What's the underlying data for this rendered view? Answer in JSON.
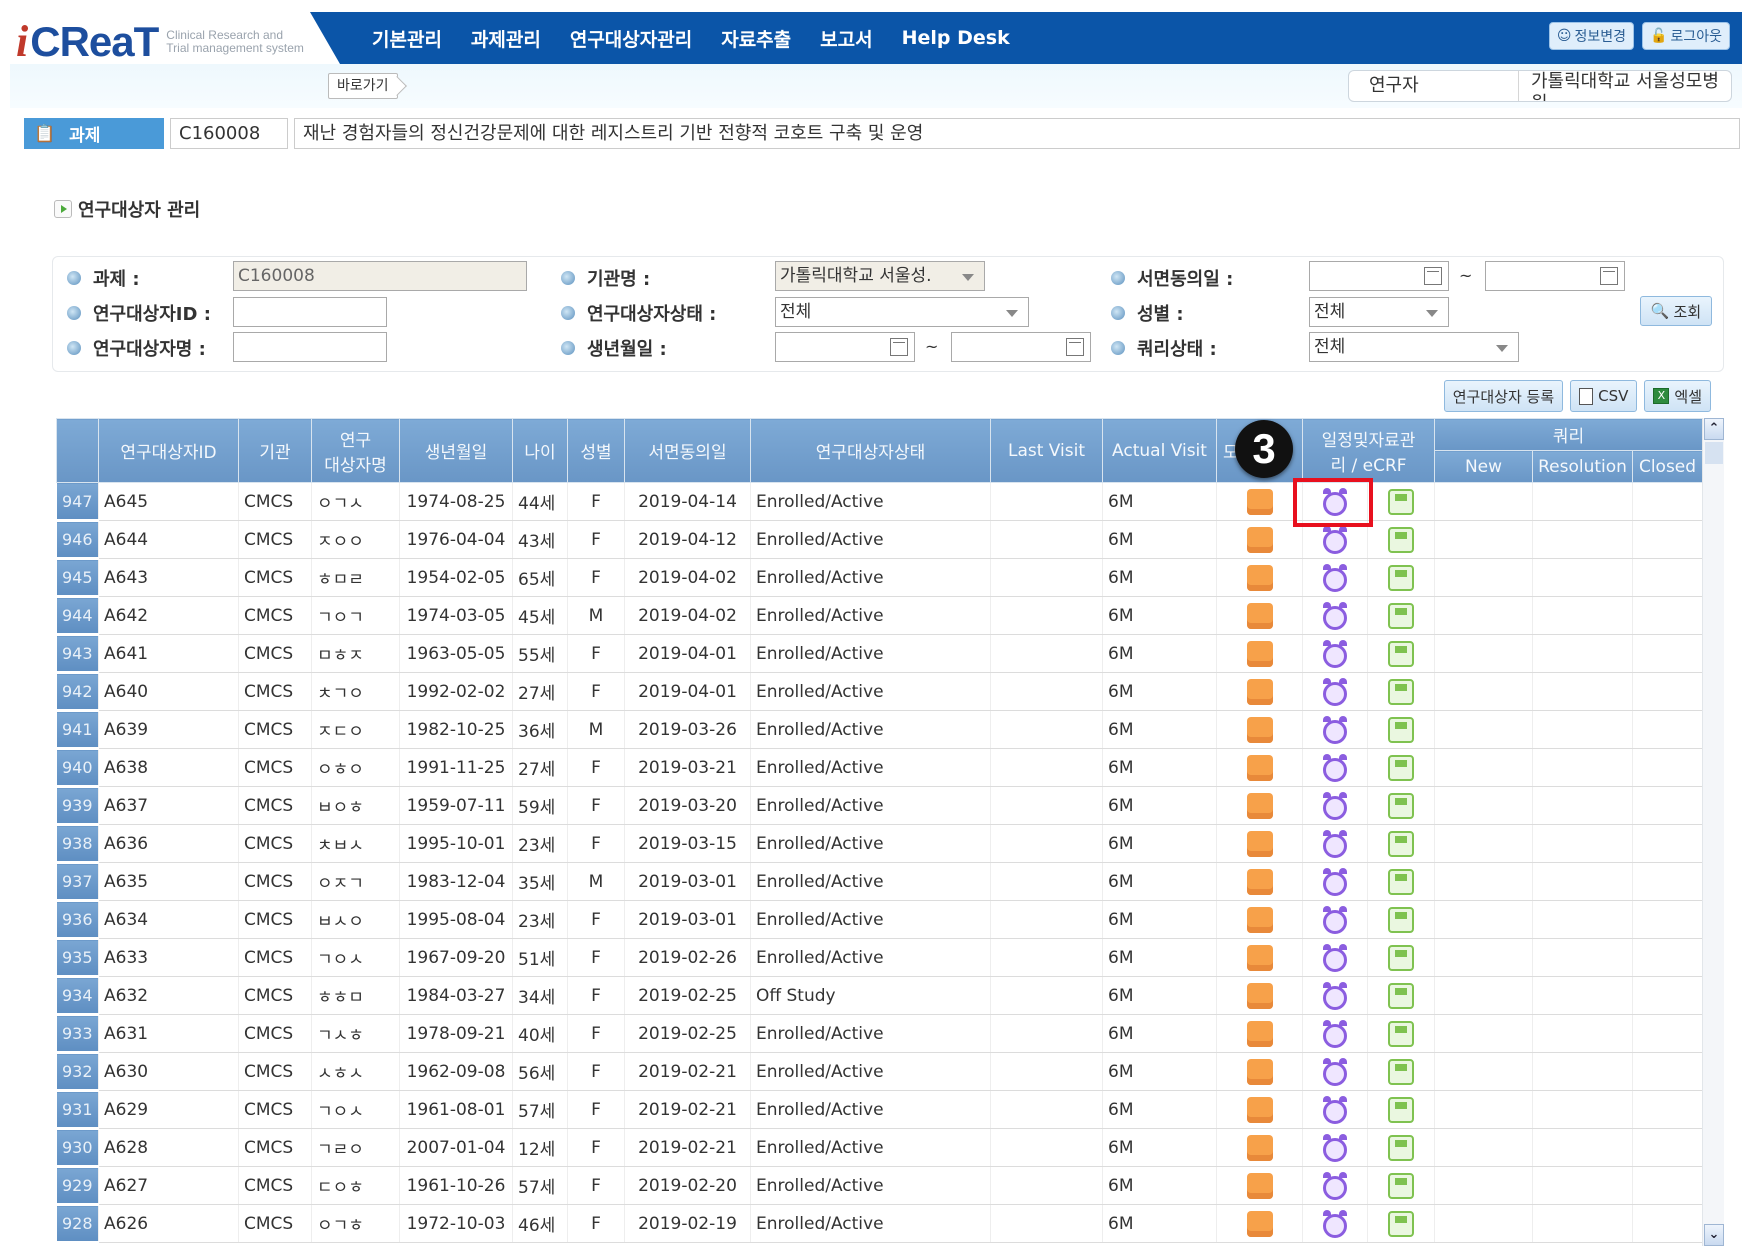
{
  "app": {
    "logo_i": "i",
    "logo_main": "CReaT",
    "logo_sub_1": "Clinical Research and",
    "logo_sub_2": "Trial management system"
  },
  "nav": {
    "items": [
      "기본관리",
      "과제관리",
      "연구대상자관리",
      "자료추출",
      "보고서",
      "Help Desk"
    ],
    "profile_button": "정보변경",
    "logout_button": "로그아웃"
  },
  "subbar": {
    "goto_label": "바로가기",
    "role": "연구자",
    "institution": "가톨릭대학교 서울성모병원"
  },
  "project": {
    "tag_label": "과제",
    "code": "C160008",
    "title": "재난 경험자들의 정신건강문제에 대한 레지스트리 기반 전향적 코호트 구축 및 운영"
  },
  "section_title": "연구대상자 관리",
  "filters": {
    "project_label": "과제 :",
    "project_value": "C160008",
    "subject_id_label": "연구대상자ID :",
    "subject_id_value": "",
    "subject_name_label": "연구대상자명 :",
    "subject_name_value": "",
    "institution_label": "기관명 :",
    "institution_value": "가톨릭대학교 서울성.",
    "status_label": "연구대상자상태 :",
    "status_value": "전체",
    "birth_label": "생년월일 :",
    "birth_from": "",
    "birth_to": "",
    "consent_label": "서면동의일 :",
    "consent_from": "",
    "consent_to": "",
    "gender_label": "성별 :",
    "gender_value": "전체",
    "query_label": "쿼리상태 :",
    "query_value": "전체",
    "range_sep": "~",
    "search_button": "조회"
  },
  "actions": {
    "register": "연구대상자 등록",
    "csv": "CSV",
    "excel": "엑셀"
  },
  "table": {
    "headers": {
      "id": "연구대상자ID",
      "institution": "기관",
      "name_1": "연구",
      "name_2": "대상자명",
      "birth": "생년월일",
      "age": "나이",
      "gender": "성별",
      "consent": "서면동의일",
      "status": "연구대상자상태",
      "last_visit": "Last Visit",
      "actual_visit": "Actual Visit",
      "monitor": "모",
      "schedule_1": "일정및자료관",
      "schedule_2": "리 / eCRF",
      "query": "쿼리",
      "q_new": "New",
      "q_resolution": "Resolution",
      "q_closed": "Closed"
    },
    "rows": [
      {
        "no": "947",
        "id": "A645",
        "inst": "CMCS",
        "name": "ㅇㄱㅅ",
        "birth": "1974-08-25",
        "age": "44세",
        "sex": "F",
        "consent": "2019-04-14",
        "status": "Enrolled/Active",
        "last": "",
        "actual": "6M"
      },
      {
        "no": "946",
        "id": "A644",
        "inst": "CMCS",
        "name": "ㅈㅇㅇ",
        "birth": "1976-04-04",
        "age": "43세",
        "sex": "F",
        "consent": "2019-04-12",
        "status": "Enrolled/Active",
        "last": "",
        "actual": "6M"
      },
      {
        "no": "945",
        "id": "A643",
        "inst": "CMCS",
        "name": "ㅎㅁㄹ",
        "birth": "1954-02-05",
        "age": "65세",
        "sex": "F",
        "consent": "2019-04-02",
        "status": "Enrolled/Active",
        "last": "",
        "actual": "6M"
      },
      {
        "no": "944",
        "id": "A642",
        "inst": "CMCS",
        "name": "ㄱㅇㄱ",
        "birth": "1974-03-05",
        "age": "45세",
        "sex": "M",
        "consent": "2019-04-02",
        "status": "Enrolled/Active",
        "last": "",
        "actual": "6M"
      },
      {
        "no": "943",
        "id": "A641",
        "inst": "CMCS",
        "name": "ㅁㅎㅈ",
        "birth": "1963-05-05",
        "age": "55세",
        "sex": "F",
        "consent": "2019-04-01",
        "status": "Enrolled/Active",
        "last": "",
        "actual": "6M"
      },
      {
        "no": "942",
        "id": "A640",
        "inst": "CMCS",
        "name": "ㅊㄱㅇ",
        "birth": "1992-02-02",
        "age": "27세",
        "sex": "F",
        "consent": "2019-04-01",
        "status": "Enrolled/Active",
        "last": "",
        "actual": "6M"
      },
      {
        "no": "941",
        "id": "A639",
        "inst": "CMCS",
        "name": "ㅈㄷㅇ",
        "birth": "1982-10-25",
        "age": "36세",
        "sex": "M",
        "consent": "2019-03-26",
        "status": "Enrolled/Active",
        "last": "",
        "actual": "6M"
      },
      {
        "no": "940",
        "id": "A638",
        "inst": "CMCS",
        "name": "ㅇㅎㅇ",
        "birth": "1991-11-25",
        "age": "27세",
        "sex": "F",
        "consent": "2019-03-21",
        "status": "Enrolled/Active",
        "last": "",
        "actual": "6M"
      },
      {
        "no": "939",
        "id": "A637",
        "inst": "CMCS",
        "name": "ㅂㅇㅎ",
        "birth": "1959-07-11",
        "age": "59세",
        "sex": "F",
        "consent": "2019-03-20",
        "status": "Enrolled/Active",
        "last": "",
        "actual": "6M"
      },
      {
        "no": "938",
        "id": "A636",
        "inst": "CMCS",
        "name": "ㅊㅂㅅ",
        "birth": "1995-10-01",
        "age": "23세",
        "sex": "F",
        "consent": "2019-03-15",
        "status": "Enrolled/Active",
        "last": "",
        "actual": "6M"
      },
      {
        "no": "937",
        "id": "A635",
        "inst": "CMCS",
        "name": "ㅇㅈㄱ",
        "birth": "1983-12-04",
        "age": "35세",
        "sex": "M",
        "consent": "2019-03-01",
        "status": "Enrolled/Active",
        "last": "",
        "actual": "6M"
      },
      {
        "no": "936",
        "id": "A634",
        "inst": "CMCS",
        "name": "ㅂㅅㅇ",
        "birth": "1995-08-04",
        "age": "23세",
        "sex": "F",
        "consent": "2019-03-01",
        "status": "Enrolled/Active",
        "last": "",
        "actual": "6M"
      },
      {
        "no": "935",
        "id": "A633",
        "inst": "CMCS",
        "name": "ㄱㅇㅅ",
        "birth": "1967-09-20",
        "age": "51세",
        "sex": "F",
        "consent": "2019-02-26",
        "status": "Enrolled/Active",
        "last": "",
        "actual": "6M"
      },
      {
        "no": "934",
        "id": "A632",
        "inst": "CMCS",
        "name": "ㅎㅎㅁ",
        "birth": "1984-03-27",
        "age": "34세",
        "sex": "F",
        "consent": "2019-02-25",
        "status": "Off Study",
        "last": "",
        "actual": "6M"
      },
      {
        "no": "933",
        "id": "A631",
        "inst": "CMCS",
        "name": "ㄱㅅㅎ",
        "birth": "1978-09-21",
        "age": "40세",
        "sex": "F",
        "consent": "2019-02-25",
        "status": "Enrolled/Active",
        "last": "",
        "actual": "6M"
      },
      {
        "no": "932",
        "id": "A630",
        "inst": "CMCS",
        "name": "ㅅㅎㅅ",
        "birth": "1962-09-08",
        "age": "56세",
        "sex": "F",
        "consent": "2019-02-21",
        "status": "Enrolled/Active",
        "last": "",
        "actual": "6M"
      },
      {
        "no": "931",
        "id": "A629",
        "inst": "CMCS",
        "name": "ㄱㅇㅅ",
        "birth": "1961-08-01",
        "age": "57세",
        "sex": "F",
        "consent": "2019-02-21",
        "status": "Enrolled/Active",
        "last": "",
        "actual": "6M"
      },
      {
        "no": "930",
        "id": "A628",
        "inst": "CMCS",
        "name": "ㄱㄹㅇ",
        "birth": "2007-01-04",
        "age": "12세",
        "sex": "F",
        "consent": "2019-02-21",
        "status": "Enrolled/Active",
        "last": "",
        "actual": "6M"
      },
      {
        "no": "929",
        "id": "A627",
        "inst": "CMCS",
        "name": "ㄷㅇㅎ",
        "birth": "1961-10-26",
        "age": "57세",
        "sex": "F",
        "consent": "2019-02-20",
        "status": "Enrolled/Active",
        "last": "",
        "actual": "6M"
      },
      {
        "no": "928",
        "id": "A626",
        "inst": "CMCS",
        "name": "ㅇㄱㅎ",
        "birth": "1972-10-03",
        "age": "46세",
        "sex": "F",
        "consent": "2019-02-19",
        "status": "Enrolled/Active",
        "last": "",
        "actual": "6M"
      }
    ]
  },
  "annotation": {
    "step_number": "3"
  },
  "scrollbar": {
    "up": "⌃",
    "down": "⌄"
  }
}
